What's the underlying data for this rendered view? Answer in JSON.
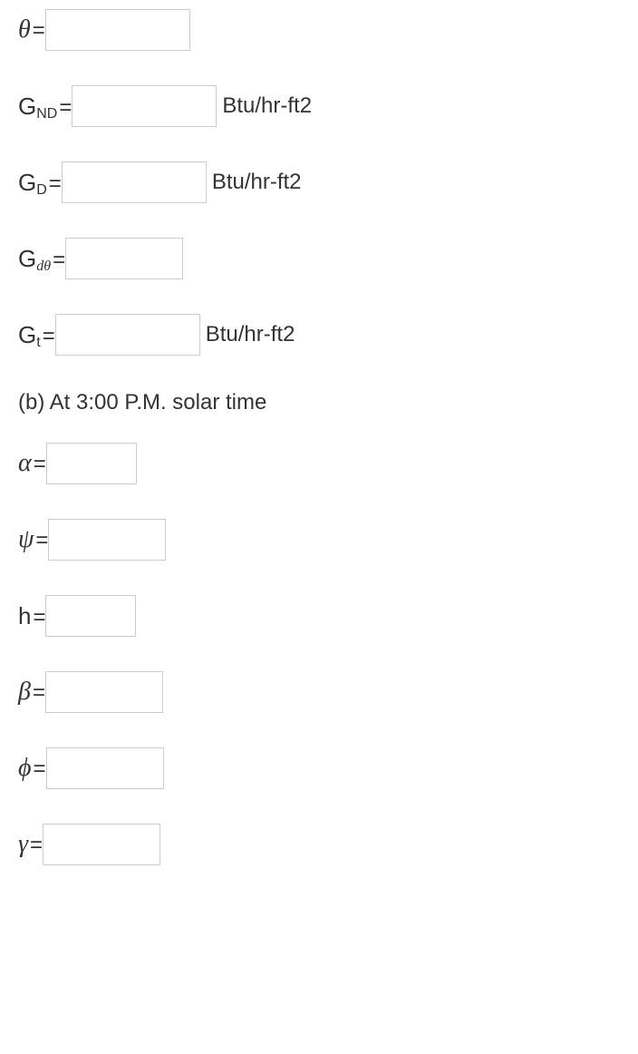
{
  "rows": [
    {
      "id": "theta",
      "symbol": "θ",
      "symbolClass": "symbol",
      "sub": "",
      "subClass": "",
      "inputClass": "w-large",
      "unit": ""
    },
    {
      "id": "gnd",
      "symbol": "G",
      "symbolClass": "symbol-upright",
      "sub": "ND",
      "subClass": "sub",
      "inputClass": "w-large",
      "unit": "Btu/hr-ft2"
    },
    {
      "id": "gd",
      "symbol": "G",
      "symbolClass": "symbol-upright",
      "sub": "D",
      "subClass": "sub",
      "inputClass": "w-large",
      "unit": "Btu/hr-ft2"
    },
    {
      "id": "gdtheta",
      "symbol": "G",
      "symbolClass": "symbol-upright",
      "sub": "dθ",
      "subClass": "sub sub-italic",
      "inputClass": "w-med",
      "unit": ""
    },
    {
      "id": "gt",
      "symbol": "G",
      "symbolClass": "symbol-upright",
      "sub": "t",
      "subClass": "sub",
      "inputClass": "w-large",
      "unit": "Btu/hr-ft2"
    }
  ],
  "section_b_label": "(b) At 3:00 P.M. solar time",
  "rows_b": [
    {
      "id": "alpha",
      "symbol": "α",
      "symbolClass": "symbol",
      "sub": "",
      "subClass": "",
      "inputClass": "w-small",
      "unit": ""
    },
    {
      "id": "psi",
      "symbol": "ψ",
      "symbolClass": "symbol",
      "sub": "",
      "subClass": "",
      "inputClass": "w-med",
      "unit": ""
    },
    {
      "id": "h",
      "symbol": "h",
      "symbolClass": "symbol-upright",
      "sub": "",
      "subClass": "",
      "inputClass": "w-small",
      "unit": ""
    },
    {
      "id": "beta",
      "symbol": "β",
      "symbolClass": "symbol",
      "sub": "",
      "subClass": "",
      "inputClass": "w-med",
      "unit": ""
    },
    {
      "id": "phi",
      "symbol": "ϕ",
      "symbolClass": "symbol",
      "sub": "",
      "subClass": "",
      "inputClass": "w-med",
      "unit": ""
    },
    {
      "id": "gamma",
      "symbol": "γ",
      "symbolClass": "symbol",
      "sub": "",
      "subClass": "",
      "inputClass": "w-med",
      "unit": ""
    }
  ],
  "eq": "="
}
